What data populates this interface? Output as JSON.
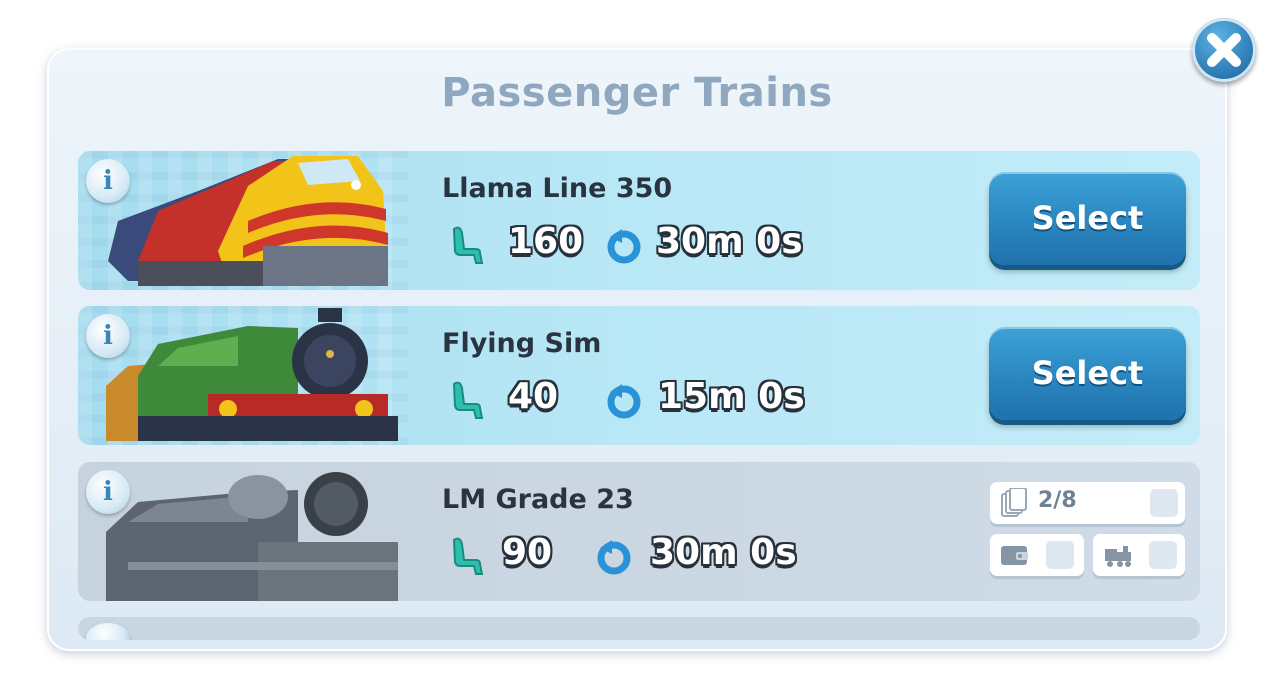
{
  "dialog": {
    "title": "Passenger Trains"
  },
  "trains": [
    {
      "name": "Llama Line 350",
      "capacity": "160",
      "time": "30m 0s",
      "select_label": "Select"
    },
    {
      "name": "Flying Sim",
      "capacity": "40",
      "time": "15m 0s",
      "select_label": "Select"
    },
    {
      "name": "LM Grade 23",
      "capacity": "90",
      "time": "30m 0s",
      "requirement": {
        "cards": "2/8"
      }
    }
  ],
  "info_label": "i",
  "icons": {
    "close": "close-icon",
    "info": "info-icon",
    "capacity": "seat-icon",
    "time": "refresh-icon",
    "cards": "cards-icon",
    "wallet": "wallet-icon",
    "train": "train-icon"
  },
  "colors": {
    "title": "#8fa8bf",
    "select_button": "#2a86c0",
    "capacity_icon": "#2bbfae",
    "time_icon": "#2a92d6"
  }
}
